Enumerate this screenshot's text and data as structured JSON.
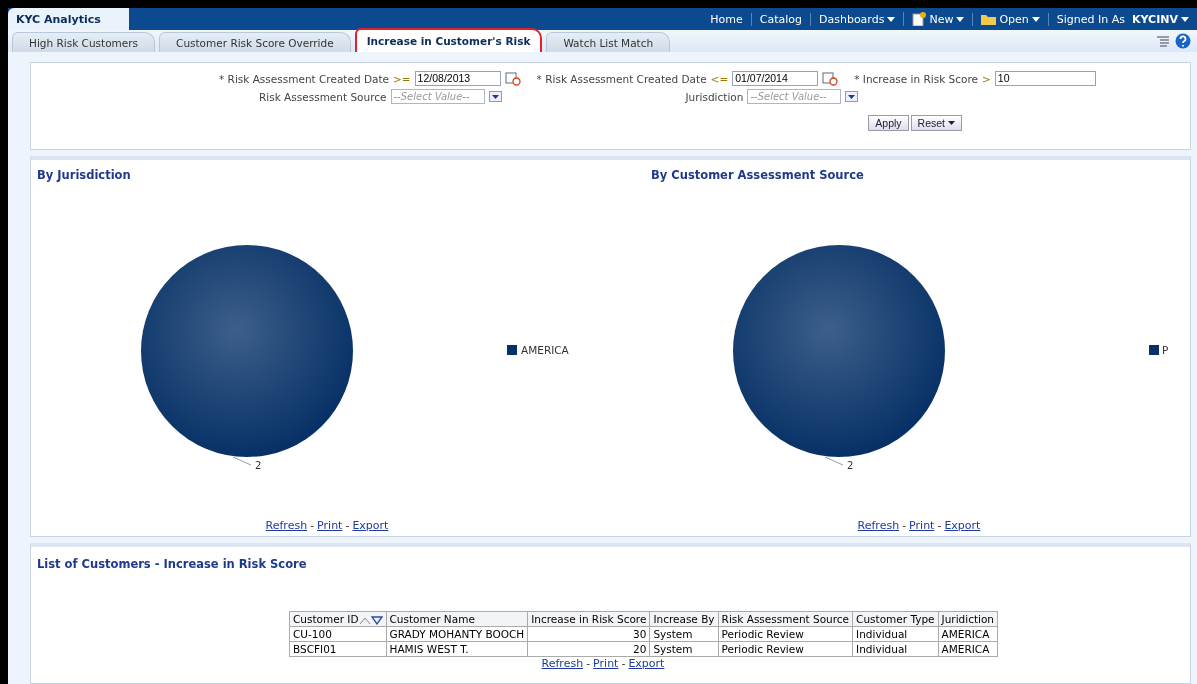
{
  "app_title": "KYC Analytics",
  "global_links": [
    {
      "label": "Home",
      "kind": "link"
    },
    {
      "label": "Catalog",
      "kind": "link"
    },
    {
      "label": "Dashboards",
      "kind": "menu"
    },
    {
      "label": "New",
      "kind": "new"
    },
    {
      "label": "Open",
      "kind": "open"
    },
    {
      "label": "Signed In As",
      "kind": "user",
      "user": "KYCINV"
    }
  ],
  "tabs": [
    {
      "label": "High Risk Customers",
      "selected": false
    },
    {
      "label": "Customer Risk Score Override",
      "selected": false
    },
    {
      "label": "Increase in Customer's Risk",
      "selected": true
    },
    {
      "label": "Watch List Match",
      "selected": false
    }
  ],
  "filters": {
    "row1": [
      {
        "label": "* Risk Assessment Created Date",
        "op": ">=",
        "value": "12/08/2013",
        "kind": "date"
      },
      {
        "label": "* Risk Assessment Created Date",
        "op": "<=",
        "value": "01/07/2014",
        "kind": "date"
      },
      {
        "label": "* Increase in Risk Score",
        "op": ">",
        "value": "10",
        "kind": "text"
      }
    ],
    "row2": [
      {
        "label": "Risk Assessment Source",
        "placeholder": "--Select Value--"
      },
      {
        "label": "Jurisdiction",
        "placeholder": "--Select Value--"
      }
    ],
    "buttons": [
      "Apply",
      "Reset"
    ]
  },
  "charts": [
    {
      "title": "By Jurisdiction",
      "chart_data": {
        "type": "pie",
        "categories": [
          "AMERICA"
        ],
        "values": [
          2
        ],
        "data_labels": true
      },
      "links": [
        {
          "label": "Refresh"
        },
        {
          "prefix": "-",
          "label": "Print"
        },
        {
          "prefix": "-",
          "label": "Export"
        }
      ]
    },
    {
      "title": "By Customer Assessment Source",
      "chart_data": {
        "type": "pie",
        "categories": [
          "P"
        ],
        "values": [
          2
        ],
        "data_labels": true
      },
      "links": [
        {
          "label": "Refresh"
        },
        {
          "prefix": "-",
          "label": "Print"
        },
        {
          "prefix": "-",
          "label": "Export"
        }
      ]
    }
  ],
  "table": {
    "title": "List of Customers - Increase in Risk Score",
    "columns": [
      "Customer ID",
      "Customer Name",
      "Increase in Risk Score",
      "Increase By",
      "Risk Assessment Source",
      "Customer Type",
      "Juridiction"
    ],
    "rows": [
      [
        "CU-100",
        "GRADY MOHANTY BOOCH",
        "30",
        "System",
        "Periodic Review",
        "Individual",
        "AMERICA"
      ],
      [
        "BSCFI01",
        "HAMIS WEST T.",
        "20",
        "System",
        "Periodic Review",
        "Individual",
        "AMERICA"
      ]
    ],
    "links": [
      {
        "label": "Refresh"
      },
      {
        "prefix": "-",
        "label": "Print"
      },
      {
        "prefix": "-",
        "label": "Export"
      }
    ]
  }
}
